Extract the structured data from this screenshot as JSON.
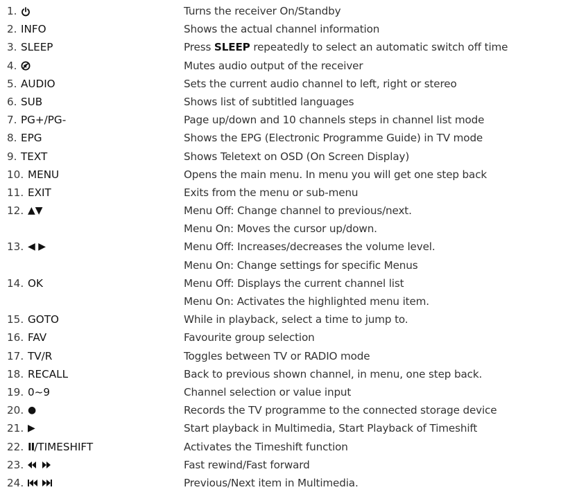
{
  "rows": [
    {
      "n": "1.",
      "key": "⏻",
      "icon": "power-icon",
      "desc": "Turns the receiver On/Standby"
    },
    {
      "n": "2.",
      "key": "INFO",
      "desc": "Shows the actual channel information"
    },
    {
      "n": "3.",
      "key": "SLEEP",
      "desc_pre": "Press ",
      "desc_bold": "SLEEP",
      "desc_post": " repeatedly to select an automatic switch off time"
    },
    {
      "n": "4.",
      "key": "mute",
      "icon": "mute-icon",
      "desc": "Mutes audio output of the receiver"
    },
    {
      "n": "5.",
      "key": "AUDIO",
      "desc": "Sets the current audio channel to left, right or stereo"
    },
    {
      "n": "6.",
      "key": "SUB",
      "desc": "Shows list of subtitled languages"
    },
    {
      "n": "7.",
      "key": "PG+/PG-",
      "desc": "Page up/down and 10 channels steps in channel list mode"
    },
    {
      "n": "8.",
      "key": "EPG",
      "desc": "Shows the EPG (Electronic Programme Guide) in TV mode"
    },
    {
      "n": "9.",
      "key": "TEXT",
      "desc": "Shows Teletext on OSD (On Screen Display)"
    },
    {
      "n": "10.",
      "key": "MENU",
      "desc": "Opens the main menu. In menu you will get one step back"
    },
    {
      "n": "11.",
      "key": "EXIT",
      "desc": "Exits from the menu or sub-menu"
    },
    {
      "n": "12.",
      "key": "▲▼",
      "icon": "up-down-arrows-icon",
      "desc": "Menu Off: Change channel to previous/next."
    },
    {
      "n": "",
      "key": "",
      "desc": "Menu On: Moves the cursor up/down."
    },
    {
      "n": "13.",
      "key": "◀ ▶",
      "icon": "left-right-arrows-icon",
      "desc": "Menu Off: Increases/decreases the volume level."
    },
    {
      "n": "",
      "key": "",
      "desc": "Menu On: Change settings for specific Menus"
    },
    {
      "n": "14.",
      "key": "OK",
      "desc": "Menu Off: Displays the current channel list"
    },
    {
      "n": "",
      "key": "",
      "desc": "Menu On: Activates the highlighted menu item."
    },
    {
      "n": "15.",
      "key": "GOTO",
      "desc": "While in playback, select a time to jump to."
    },
    {
      "n": "16.",
      "key": "FAV",
      "desc": "Favourite group selection"
    },
    {
      "n": "17.",
      "key": "TV/R",
      "desc": "Toggles between TV or RADIO mode"
    },
    {
      "n": "18.",
      "key": "RECALL",
      "desc": "Back to previous shown channel, in menu, one step back."
    },
    {
      "n": "19.",
      "key": "0~9",
      "desc": "Channel selection or value input"
    },
    {
      "n": "20.",
      "key": "●",
      "icon": "record-icon",
      "desc": "Records the TV programme to the connected storage device"
    },
    {
      "n": "21.",
      "key": "▶",
      "icon": "play-icon",
      "desc": "Start playback in Multimedia, Start Playback of Timeshift"
    },
    {
      "n": "22.",
      "key": "II/TIMESHIFT",
      "key_pre": "II",
      "key_post": "/TIMESHIFT",
      "icon": "pause-icon",
      "desc": "Activates the Timeshift function"
    },
    {
      "n": "23.",
      "key": "◀◀ ▶▶",
      "icon": "rewind-forward-icon",
      "desc": "Fast rewind/Fast forward"
    },
    {
      "n": "24.",
      "key": "⏮ ⏭",
      "icon": "prev-next-icon",
      "desc": "Previous/Next item in Multimedia."
    }
  ]
}
